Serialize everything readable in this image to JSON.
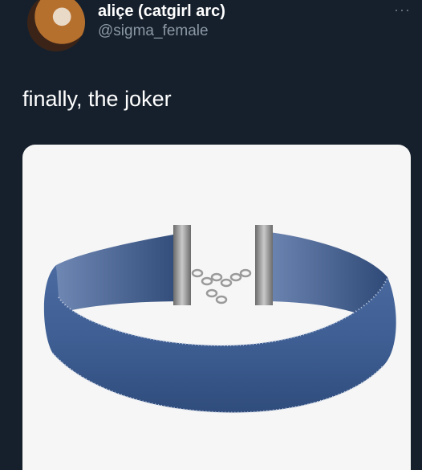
{
  "user": {
    "display_name": "aliçe (catgirl arc)",
    "handle": "@sigma_female",
    "avatar_icon": "profile-avatar"
  },
  "more_label": "···",
  "tweet": {
    "text": "finally, the joker"
  },
  "media": {
    "subject": "denim-choker-icon",
    "colors": {
      "background": "#f6f6f6",
      "denim": "#3f5f94",
      "metal": "#8f8f8f"
    }
  },
  "theme": {
    "background": "#16202c",
    "secondary_text": "#8b98a5"
  }
}
